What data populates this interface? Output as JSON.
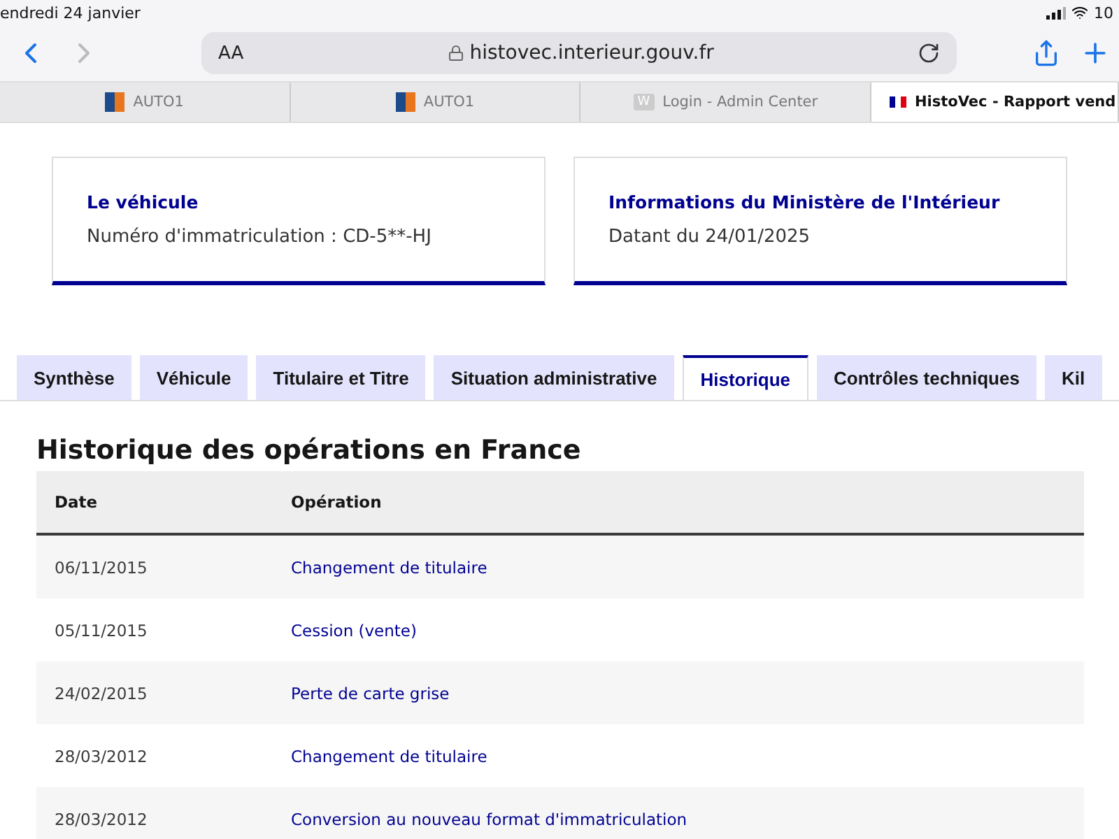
{
  "status_bar": {
    "date": "endredi 24 janvier",
    "battery": "10"
  },
  "toolbar": {
    "text_size": "AA",
    "url": "histovec.interieur.gouv.fr"
  },
  "browser_tabs": [
    {
      "title": "AUTO1",
      "kind": "logo",
      "selected": false
    },
    {
      "title": "AUTO1",
      "kind": "logo",
      "selected": false
    },
    {
      "title": "Login - Admin Center",
      "kind": "letter",
      "favicon": "W",
      "selected": false
    },
    {
      "title": "HistoVec - Rapport vend",
      "kind": "flag",
      "selected": true
    }
  ],
  "cards": [
    {
      "title": "Le véhicule",
      "text": "Numéro d'immatriculation : CD-5**-HJ"
    },
    {
      "title": "Informations du Ministère de l'Intérieur",
      "text": "Datant du 24/01/2025"
    }
  ],
  "tabs": [
    {
      "label": "Synthèse",
      "selected": false
    },
    {
      "label": "Véhicule",
      "selected": false
    },
    {
      "label": "Titulaire et Titre",
      "selected": false
    },
    {
      "label": "Situation administrative",
      "selected": false
    },
    {
      "label": "Historique",
      "selected": true
    },
    {
      "label": "Contrôles techniques",
      "selected": false
    },
    {
      "label": "Kil",
      "selected": false
    }
  ],
  "section": {
    "title": "Historique des opérations en France",
    "table": {
      "columns": [
        "Date",
        "Opération"
      ],
      "rows": [
        [
          "06/11/2015",
          "Changement de titulaire"
        ],
        [
          "05/11/2015",
          "Cession (vente)"
        ],
        [
          "24/02/2015",
          "Perte de carte grise"
        ],
        [
          "28/03/2012",
          "Changement de titulaire"
        ],
        [
          "28/03/2012",
          "Conversion au nouveau format d'immatriculation"
        ]
      ]
    }
  }
}
